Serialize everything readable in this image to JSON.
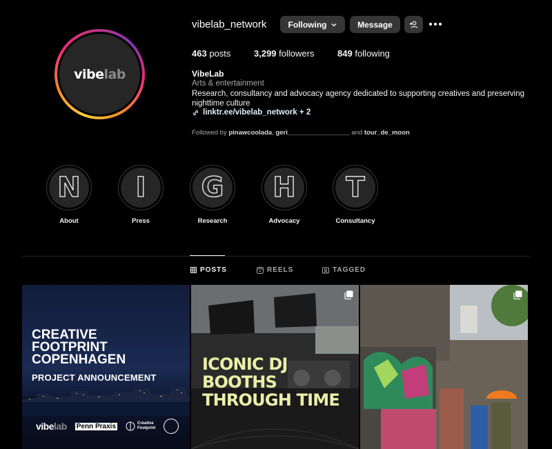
{
  "profile": {
    "username": "vibelab_network",
    "logo_main": "vibe",
    "logo_dim": "lab",
    "following_label": "Following",
    "message_label": "Message",
    "stats": {
      "posts_count": "463",
      "posts_label": "posts",
      "followers_count": "3,299",
      "followers_label": "followers",
      "following_count": "849",
      "following_label": "following"
    },
    "full_name": "VibeLab",
    "category": "Arts & entertainment",
    "bio": "Research, consultancy and advocacy agency dedicated to supporting creatives and preserving nighttime culture",
    "link": "linktr.ee/vibelab_network + 2",
    "followed_by": {
      "prefix": "Followed by ",
      "user1": "pinawcoolada",
      "sep": ", ",
      "user2": "geri_________________",
      "and": " and ",
      "user3": "tour_de_moon"
    }
  },
  "highlights": [
    {
      "letter": "N",
      "label": "About"
    },
    {
      "letter": "I",
      "label": "Press"
    },
    {
      "letter": "G",
      "label": "Research"
    },
    {
      "letter": "H",
      "label": "Advocacy"
    },
    {
      "letter": "T",
      "label": "Consultancy"
    }
  ],
  "tabs": [
    {
      "label": "POSTS",
      "icon": "grid-icon",
      "active": true
    },
    {
      "label": "REELS",
      "icon": "reels-icon",
      "active": false
    },
    {
      "label": "TAGGED",
      "icon": "tagged-icon",
      "active": false
    }
  ],
  "posts": [
    {
      "headline_lines": [
        "CREATIVE",
        "FOOTPRINT",
        "COPENHAGEN"
      ],
      "subline": "PROJECT ANNOUNCEMENT",
      "logo_vibe": "vibe",
      "logo_lab": "lab",
      "logo_pp": "Penn Praxis",
      "logo_cf": [
        "Creative",
        "Footprint"
      ]
    },
    {
      "headline_lines": [
        "ICONIC DJ",
        "BOOTHS",
        "THROUGH TIME"
      ]
    },
    {}
  ],
  "colors": {
    "background": "#000000",
    "button_bg": "#363636",
    "secondary_text": "#a8a8a8",
    "link": "#e0f1ff",
    "post2_headline": "#e8f0a8"
  }
}
